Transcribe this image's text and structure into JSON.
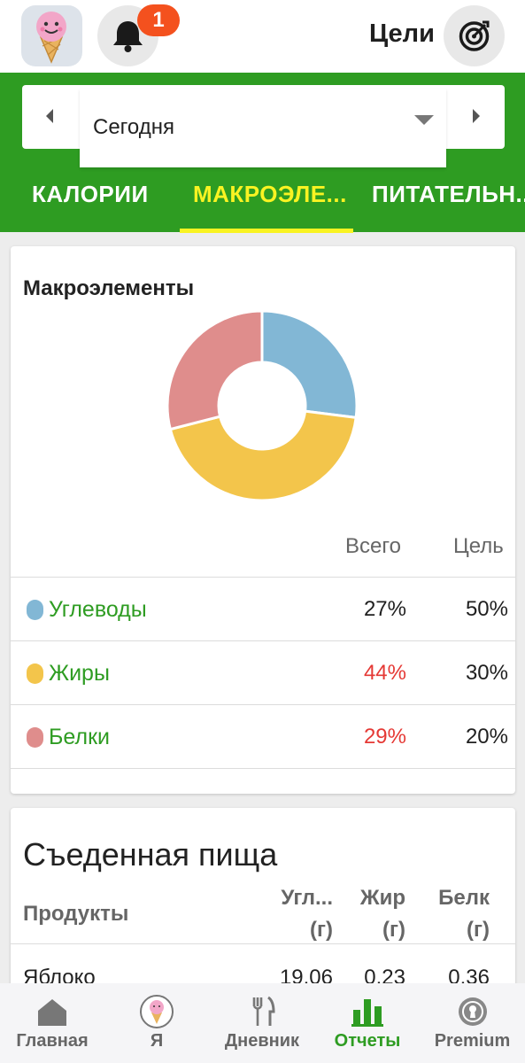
{
  "header": {
    "notification_count": "1",
    "goals_label": "Цели"
  },
  "date": {
    "selected": "Сегодня"
  },
  "tabs": [
    {
      "label": "КАЛОРИИ",
      "active": false
    },
    {
      "label": "МАКРОЭЛЕ...",
      "active": true
    },
    {
      "label": "ПИТАТЕЛЬН...",
      "active": false
    }
  ],
  "macros_card": {
    "title": "Макроэлементы",
    "col_total": "Всего",
    "col_goal": "Цель",
    "rows": [
      {
        "label": "Углеводы",
        "total": "27%",
        "goal": "50%",
        "color": "#82b7d5",
        "over": false
      },
      {
        "label": "Жиры",
        "total": "44%",
        "goal": "30%",
        "color": "#f3c54b",
        "over": true
      },
      {
        "label": "Белки",
        "total": "29%",
        "goal": "20%",
        "color": "#df8d8c",
        "over": true
      }
    ]
  },
  "chart_data": {
    "type": "pie",
    "categories": [
      "Углеводы",
      "Жиры",
      "Белки"
    ],
    "values": [
      27,
      44,
      29
    ],
    "colors": [
      "#82b7d5",
      "#f3c54b",
      "#df8d8c"
    ],
    "donut": true
  },
  "food_card": {
    "title": "Съеденная пища",
    "col_products": "Продукты",
    "col_carbs": "Угл...",
    "col_fat": "Жир",
    "col_protein": "Белк",
    "unit": "(г)",
    "items": [
      {
        "name": "Яблоко",
        "carbs": "19.06",
        "fat": "0.23",
        "protein": "0.36"
      }
    ]
  },
  "bottom_nav": [
    {
      "label": "Главная",
      "icon": "home-icon",
      "active": false
    },
    {
      "label": "Я",
      "icon": "avatar-icon",
      "active": false
    },
    {
      "label": "Дневник",
      "icon": "fork-knife-icon",
      "active": false
    },
    {
      "label": "Отчеты",
      "icon": "bar-chart-icon",
      "active": true
    },
    {
      "label": "Premium",
      "icon": "premium-badge-icon",
      "active": false
    }
  ],
  "colors": {
    "brand_green": "#2e9c22",
    "tab_active": "#f9f322",
    "over_goal": "#e53935",
    "badge": "#f4511e"
  }
}
